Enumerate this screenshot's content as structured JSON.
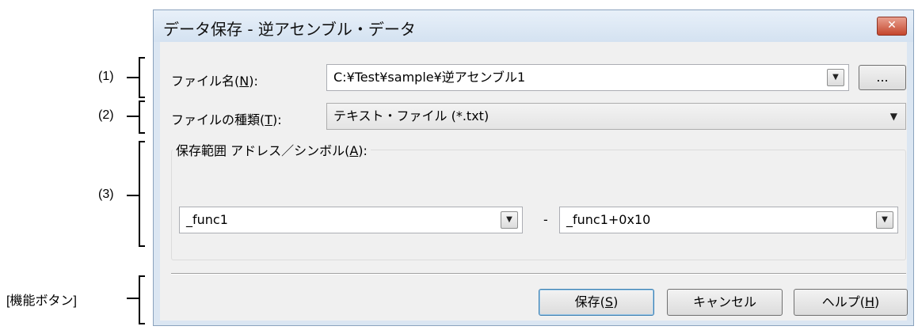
{
  "annotations": {
    "a1": "(1)",
    "a2": "(2)",
    "a3": "(3)",
    "a4": "[機能ボタン]"
  },
  "dialog": {
    "title": "データ保存 - 逆アセンブル・データ",
    "close_glyph": "✕",
    "file_name": {
      "label_pre": "ファイル名(",
      "label_key": "N",
      "label_post": "):",
      "value": "C:¥Test¥sample¥逆アセンブル1",
      "browse_label": "..."
    },
    "file_type": {
      "label_pre": "ファイルの種類(",
      "label_key": "T",
      "label_post": "):",
      "value": "テキスト・ファイル (*.txt)"
    },
    "range": {
      "title_pre": "保存範囲 アドレス／シンボル(",
      "title_key": "A",
      "title_post": "):",
      "start_value": "_func1",
      "separator": "-",
      "end_value": "_func1+0x10"
    },
    "buttons": {
      "save_pre": "保存(",
      "save_key": "S",
      "save_post": ")",
      "cancel": "キャンセル",
      "help_pre": "ヘルプ(",
      "help_key": "H",
      "help_post": ")"
    }
  }
}
